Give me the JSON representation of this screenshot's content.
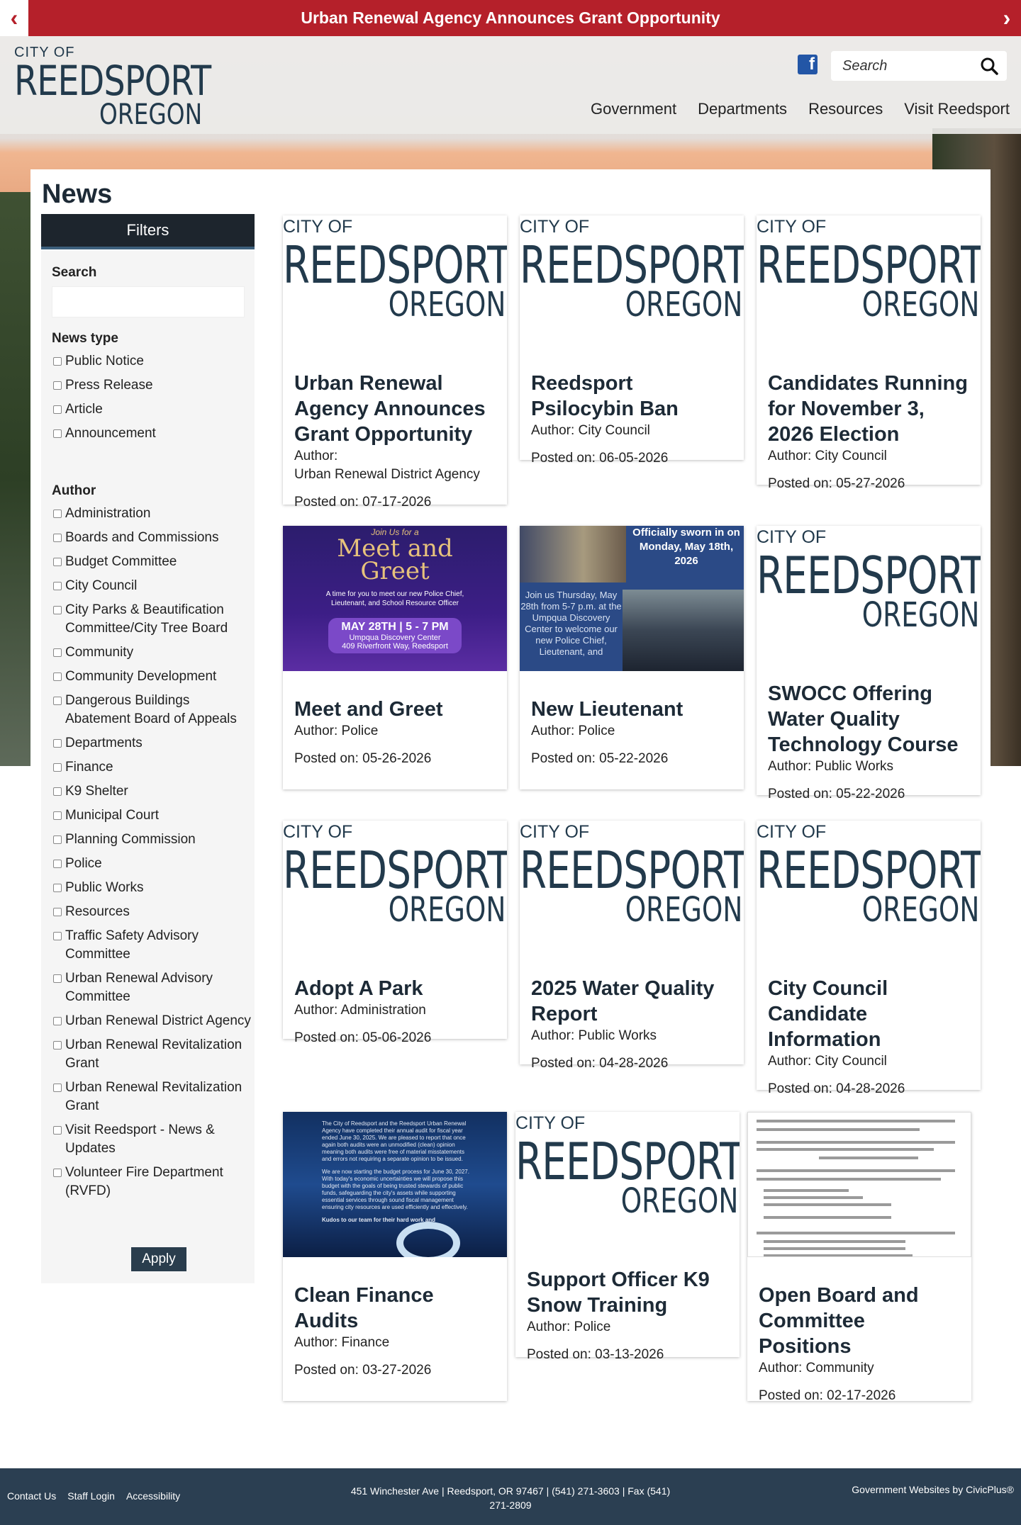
{
  "alert": {
    "text": "Urban Renewal Agency Announces Grant Opportunity",
    "prev": "‹",
    "next": "›"
  },
  "header": {
    "logo": {
      "line1": "CITY OF",
      "line2": "REEDSPORT",
      "line3": "OREGON"
    },
    "search_placeholder": "Search",
    "nav": [
      "Government",
      "Departments",
      "Resources",
      "Visit Reedsport"
    ]
  },
  "page": {
    "title": "News"
  },
  "filters": {
    "heading": "Filters",
    "search_label": "Search",
    "news_type_label": "News type",
    "news_types": [
      "Public Notice",
      "Press Release",
      "Article",
      "Announcement"
    ],
    "author_label": "Author",
    "authors": [
      "Administration",
      "Boards and Commissions",
      "Budget Committee",
      "City Council",
      "City Parks & Beautification Committee/City Tree Board",
      "Community",
      "Community Development",
      "Dangerous Buildings Abatement Board of Appeals",
      "Departments",
      "Finance",
      "K9 Shelter",
      "Municipal Court",
      "Planning Commission",
      "Police",
      "Public Works",
      "Resources",
      "Traffic Safety Advisory Committee",
      "Urban Renewal Advisory Committee",
      "Urban Renewal District Agency",
      "Urban Renewal Revitalization Grant",
      "Urban Renewal Revitalization Grant",
      "Visit Reedsport - News & Updates",
      "Volunteer Fire Department (RVFD)"
    ],
    "apply": "Apply"
  },
  "logo_thumb": {
    "city": "CITY OF",
    "reed": "REEDSPORT",
    "oregon": "OREGON"
  },
  "cards": [
    {
      "title": "Urban Renewal Agency Announces Grant Opportunity",
      "author_label": "Author:",
      "author": "Urban Renewal District Agency",
      "date": "Posted on: 07-17-2026",
      "thumb": "logo"
    },
    {
      "title": "Reedsport Psilocybin Ban",
      "author": "Author: City Council",
      "date": "Posted on: 06-05-2026",
      "thumb": "logo"
    },
    {
      "title": "Candidates Running for November 3, 2026 Election",
      "author": "Author: City Council",
      "date": "Posted on: 05-27-2026",
      "thumb": "logo"
    },
    {
      "title": "Meet and Greet",
      "author": "Author: Police",
      "date": "Posted on: 05-26-2026",
      "thumb": "meet"
    },
    {
      "title": "New Lieutenant",
      "author": "Author: Police",
      "date": "Posted on: 05-22-2026",
      "thumb": "lieutenant"
    },
    {
      "title": "SWOCC Offering Water Quality Technology Course",
      "author": "Author: Public Works",
      "date": "Posted on: 05-22-2026",
      "thumb": "logo"
    },
    {
      "title": "Adopt A Park",
      "author": "Author: Administration",
      "date": "Posted on: 05-06-2026",
      "thumb": "logo"
    },
    {
      "title": "2025 Water Quality Report",
      "author": "Author: Public Works",
      "date": "Posted on: 04-28-2026",
      "thumb": "logo"
    },
    {
      "title": "City Council Candidate Information",
      "author": "Author: City Council",
      "date": "Posted on: 04-28-2026",
      "thumb": "logo"
    },
    {
      "title": "Clean Finance Audits",
      "author": "Author: Finance",
      "date": "Posted on: 03-27-2026",
      "thumb": "finance"
    },
    {
      "title": "Support Officer K9 Snow Training",
      "author": "Author: Police",
      "date": "Posted on: 03-13-2026",
      "thumb": "logo"
    },
    {
      "title": "Open Board and Committee Positions",
      "author": "Author: Community",
      "date": "Posted on: 02-17-2026",
      "thumb": "document"
    }
  ],
  "meet_thumb": {
    "small": "Join Us for a",
    "big1": "Meet and",
    "big2": "Greet",
    "desc": "A time for you to meet our new Police Chief, Lieutenant, and School Resource Officer",
    "when": "MAY 28TH | 5 - 7 PM",
    "where1": "Umpqua Discovery Center",
    "where2": "409 Riverfront Way, Reedsport"
  },
  "lieutenant_thumb": {
    "caption": "Officially sworn in on Monday, May 18th, 2026",
    "side": "Join us Thursday, May 28th from 5-7 p.m. at the Umpqua Discovery Center to welcome our new Police Chief, Lieutenant, and"
  },
  "finance_thumb": {
    "text1": "The City of Reedsport and the Reedsport Urban Renewal Agency have completed their annual audit for fiscal year ended June 30, 2025. We are pleased to report that once again both audits were an unmodified (clean) opinion meaning both audits were free of material misstatements and errors not requiring a separate opinion to be issued.",
    "text2": "We are now starting the budget process for June 30, 2027. With today's economic uncertainties we will propose this budget with the goals of being trusted stewards of public funds, safeguarding the city's assets while supporting essential services through sound fiscal management ensuring city resources are used efficiently and effectively.",
    "text3": "Kudos to our team for their hard work and"
  },
  "footer": {
    "links": [
      "Contact Us",
      "Staff Login",
      "Accessibility"
    ],
    "address": "451 Winchester Ave | Reedsport, OR 97467 | (541) 271-3603 | Fax (541) 271-2809",
    "credit": "Government Websites by CivicPlus®"
  }
}
